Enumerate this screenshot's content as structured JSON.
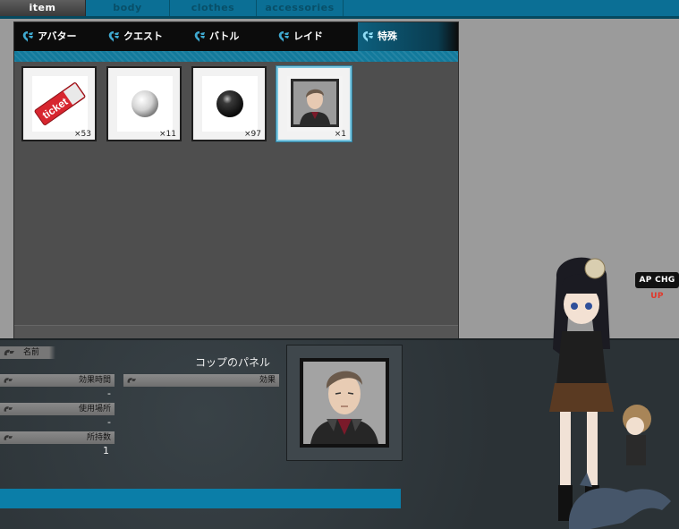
{
  "top_tabs": [
    {
      "label": "item",
      "active": true
    },
    {
      "label": "body",
      "active": false
    },
    {
      "label": "clothes",
      "active": false
    },
    {
      "label": "accessories",
      "active": false
    }
  ],
  "category_tabs": [
    {
      "label": "アバター",
      "active": false
    },
    {
      "label": "クエスト",
      "active": false
    },
    {
      "label": "バトル",
      "active": false
    },
    {
      "label": "レイド",
      "active": false
    },
    {
      "label": "特殊",
      "active": true
    }
  ],
  "items": [
    {
      "name": "ticket",
      "count": "×53",
      "icon": "ticket-icon"
    },
    {
      "name": "white-orb",
      "count": "×11",
      "icon": "white-orb-icon"
    },
    {
      "name": "black-orb",
      "count": "×97",
      "icon": "black-orb-icon"
    },
    {
      "name": "cop-panel",
      "count": "×1",
      "icon": "cop-portrait-icon",
      "selected": true
    }
  ],
  "ticket_text": "ticket",
  "detail": {
    "name_label": "名前",
    "name_value": "コップのパネル",
    "duration_label": "効果時間",
    "duration_value": "-",
    "effect_label": "効果",
    "location_label": "使用場所",
    "location_value": "-",
    "owned_label": "所持数",
    "owned_value": "1"
  },
  "apchg": {
    "prefix": "AP CHG",
    "suffix": "UP"
  },
  "colors": {
    "accent": "#0b7ea8",
    "tab_bar": "#0b6f95",
    "panel": "#4e4e4e"
  }
}
